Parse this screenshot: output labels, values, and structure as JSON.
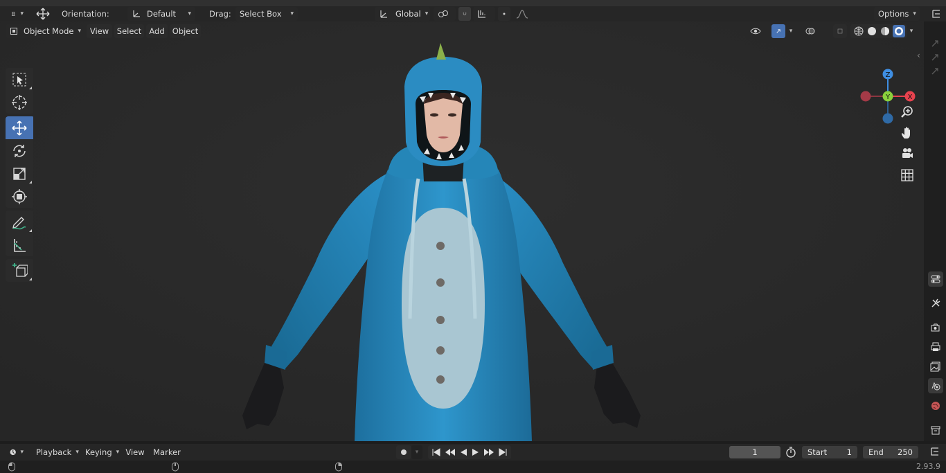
{
  "tool_header": {
    "orientation_label": "Orientation:",
    "orientation_value": "Default",
    "drag_label": "Drag:",
    "drag_value": "Select Box",
    "transform_space": "Global",
    "options_label": "Options"
  },
  "viewport_header": {
    "mode": "Object Mode",
    "menus": [
      "View",
      "Select",
      "Add",
      "Object"
    ]
  },
  "toolbar": {
    "tools": [
      {
        "icon": "select-box-icon",
        "active": false
      },
      {
        "icon": "cursor-icon",
        "active": false
      },
      {
        "icon": "move-icon",
        "active": true
      },
      {
        "icon": "rotate-icon",
        "active": false
      },
      {
        "icon": "scale-icon",
        "active": false
      },
      {
        "icon": "transform-icon",
        "active": false
      },
      {
        "icon": "annotate-icon",
        "active": false
      },
      {
        "icon": "measure-icon",
        "active": false
      },
      {
        "icon": "add-cube-icon",
        "active": false
      }
    ]
  },
  "gizmo": {
    "x": "X",
    "y": "Y",
    "z": "Z"
  },
  "timeline": {
    "menus": [
      "Playback",
      "Keying",
      "View",
      "Marker"
    ],
    "current_frame": "1",
    "start_label": "Start",
    "start_value": "1",
    "end_label": "End",
    "end_value": "250"
  },
  "status": {
    "version": "2.93.9"
  },
  "colors": {
    "accent": "#4772b3",
    "axis_x": "#e8424e",
    "axis_y": "#8ad03c",
    "axis_z": "#3f8ee2",
    "costume_blue": "#2c8fc4",
    "belly": "#a9c6d2"
  }
}
